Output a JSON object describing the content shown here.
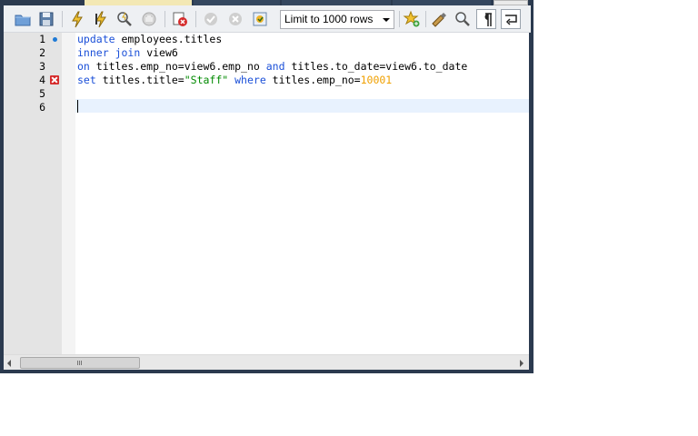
{
  "toolbar": {
    "buttons": [
      {
        "name": "open-file",
        "icon": "folder-icon"
      },
      {
        "name": "save",
        "icon": "save-icon"
      },
      {
        "name": "execute",
        "icon": "lightning-icon"
      },
      {
        "name": "execute-current",
        "icon": "lightning-cursor-icon"
      },
      {
        "name": "explain",
        "icon": "magnifier-icon"
      },
      {
        "name": "stop",
        "icon": "stop-hand-icon"
      },
      {
        "name": "toggle-error",
        "icon": "stop-on-error-icon"
      },
      {
        "name": "commit",
        "icon": "check-icon"
      },
      {
        "name": "rollback",
        "icon": "cancel-icon"
      },
      {
        "name": "autocommit",
        "icon": "autocommit-icon"
      },
      {
        "name": "add-snippet",
        "icon": "star-add-icon"
      },
      {
        "name": "beautify",
        "icon": "brush-icon"
      },
      {
        "name": "find",
        "icon": "search-icon"
      },
      {
        "name": "invisible-chars",
        "icon": "pilcrow-icon"
      },
      {
        "name": "wrap-lines",
        "icon": "wrap-icon"
      }
    ],
    "limit": {
      "value": "Limit to 1000 rows"
    }
  },
  "editor": {
    "line_numbers": [
      "1",
      "2",
      "3",
      "4",
      "5",
      "6"
    ],
    "lines": [
      [
        {
          "t": "update",
          "c": "kw"
        },
        {
          "t": " employees.titles",
          "c": ""
        }
      ],
      [
        {
          "t": "inner",
          "c": "kw"
        },
        {
          "t": " ",
          "c": ""
        },
        {
          "t": "join",
          "c": "kw"
        },
        {
          "t": " view6",
          "c": ""
        }
      ],
      [
        {
          "t": "on",
          "c": "kw"
        },
        {
          "t": " titles.emp_no=view6.emp_no ",
          "c": ""
        },
        {
          "t": "and",
          "c": "kw"
        },
        {
          "t": " titles.to_date=view6.to_date",
          "c": ""
        }
      ],
      [
        {
          "t": "set",
          "c": "kw"
        },
        {
          "t": " titles.title=",
          "c": ""
        },
        {
          "t": "\"Staff\"",
          "c": "str"
        },
        {
          "t": " ",
          "c": ""
        },
        {
          "t": "where",
          "c": "kw"
        },
        {
          "t": " titles.emp_no=",
          "c": ""
        },
        {
          "t": "10001",
          "c": "num"
        }
      ],
      [],
      []
    ],
    "markers": {
      "line1": "statement-start-dot",
      "line4": "error-marker"
    }
  },
  "colors": {
    "keyword": "#1a4fd8",
    "string": "#008a00",
    "number": "#f0a000",
    "current_line": "#e8f2fe"
  }
}
